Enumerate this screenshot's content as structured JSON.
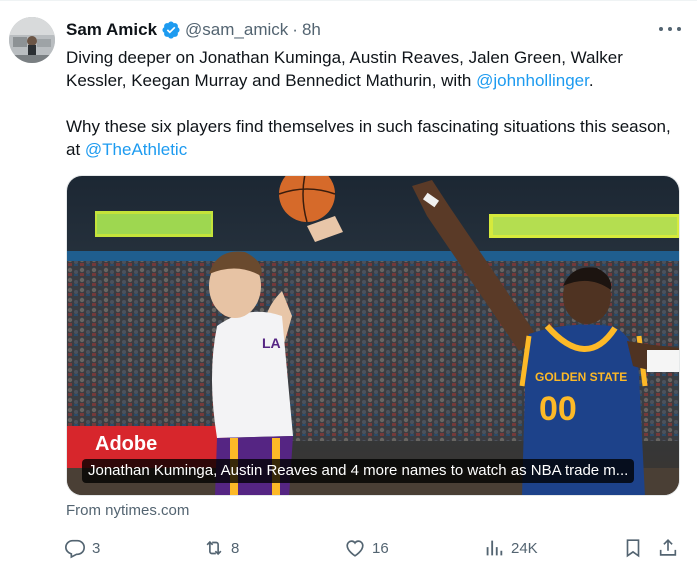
{
  "author": {
    "name": "Sam Amick",
    "handle": "@sam_amick",
    "separator": "·",
    "time": "8h"
  },
  "tweet": {
    "p1_prefix": "Diving deeper on Jonathan Kuminga, Austin Reaves, Jalen Green, Walker Kessler, Keegan Murray and Bennedict Mathurin, with ",
    "p1_mention": "@johnhollinger",
    "p1_suffix": ".",
    "p2_prefix": "Why these six players find themselves in such fascinating situations this season, at ",
    "p2_mention": "@TheAthletic"
  },
  "card": {
    "title": "Jonathan Kuminga, Austin Reaves and 4 more names to watch as NBA trade m...",
    "jersey_team": "GOLDEN STATE",
    "jersey_number": "00",
    "banner_text": "Adobe",
    "source": "From nytimes.com"
  },
  "actions": {
    "replies": "3",
    "reposts": "8",
    "likes": "16",
    "views": "24K"
  },
  "colors": {
    "accent": "#1d9bf0",
    "secondary_text": "#536471",
    "lakers_purple": "#552583",
    "warriors_gold": "#fdb927"
  },
  "icons": [
    "verified-badge-icon",
    "more-icon",
    "reply-icon",
    "repost-icon",
    "like-icon",
    "views-icon",
    "bookmark-icon",
    "share-icon"
  ]
}
